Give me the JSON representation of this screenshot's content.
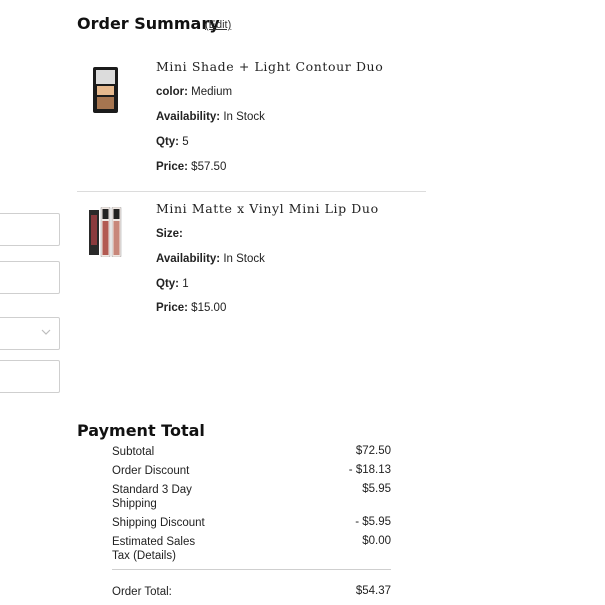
{
  "summary": {
    "title": "Order Summary",
    "edit_label": "(Edit)"
  },
  "items": [
    {
      "name": "Mini Shade + Light Contour Duo",
      "image_icon": "contour-palette-image",
      "attr1_label": "color:",
      "attr1_value": "Medium",
      "availability_label": "Availability:",
      "availability_value": "In Stock",
      "qty_label": "Qty:",
      "qty_value": "5",
      "price_label": "Price:",
      "price_value": "$57.50"
    },
    {
      "name": "Mini Matte x Vinyl Mini Lip Duo",
      "image_icon": "lip-duo-image",
      "attr1_label": "Size:",
      "attr1_value": "",
      "availability_label": "Availability:",
      "availability_value": "In Stock",
      "qty_label": "Qty:",
      "qty_value": "1",
      "price_label": "Price:",
      "price_value": "$15.00"
    }
  ],
  "payment": {
    "title": "Payment Total",
    "rows": [
      {
        "label": "Subtotal",
        "value": "$72.50"
      },
      {
        "label": "Order Discount",
        "value": "- $18.13"
      },
      {
        "label": "Standard 3 Day Shipping",
        "value": "$5.95"
      },
      {
        "label": "Shipping Discount",
        "value": "- $5.95"
      },
      {
        "label": "Estimated Sales Tax (Details)",
        "value": "$0.00"
      }
    ],
    "total_label": "Order Total:",
    "total_value": "$54.37"
  },
  "colors": {
    "text": "#1a1a1a",
    "divider": "#dcdcdc",
    "field_border": "#cfcfcf"
  }
}
